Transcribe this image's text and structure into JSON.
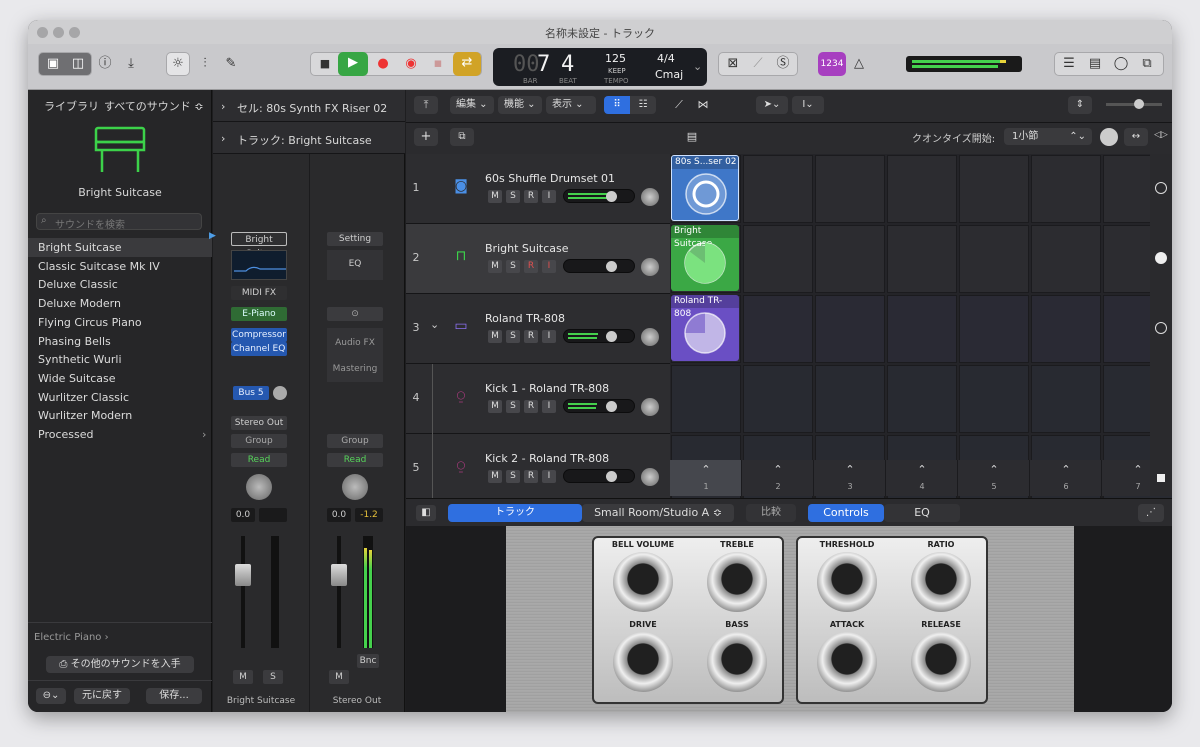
{
  "window": {
    "title": "名称未設定 - トラック"
  },
  "lcd": {
    "bar": "7",
    "beat": "4",
    "bar_label": "BAR",
    "beat_label": "BEAT",
    "tempo": "125",
    "keep": "KEEP",
    "tempo_label": "TEMPO",
    "signature": "4/4",
    "key": "Cmaj",
    "count_in": "1234"
  },
  "library": {
    "header_left": "ライブラリ",
    "header_right": "すべてのサウンド ≎",
    "patch_name": "Bright Suitcase",
    "search_placeholder": "サウンドを検索",
    "items": [
      "Bright Suitcase",
      "Classic Suitcase Mk IV",
      "Deluxe Classic",
      "Deluxe Modern",
      "Flying Circus Piano",
      "Phasing Bells",
      "Synthetic Wurli",
      "Wide Suitcase",
      "Wurlitzer Classic",
      "Wurlitzer Modern",
      "Processed"
    ],
    "footer_category": "Electric Piano",
    "get_more": "その他のサウンドを入手",
    "revert": "元に戻す",
    "save": "保存..."
  },
  "inspector": {
    "cell_label": "セル: 80s Synth FX Riser 02",
    "track_label": "トラック: Bright Suitcase",
    "strip1": {
      "setting": "Bright Suit...",
      "midi_fx": "MIDI FX",
      "instrument": "E-Piano",
      "fx1": "Compressor",
      "fx2": "Channel EQ",
      "send": "Bus 5",
      "output": "Stereo Out",
      "group": "Group",
      "automation": "Read",
      "pan_value": "0.0",
      "m": "M",
      "s": "S",
      "name": "Bright Suitcase"
    },
    "strip2": {
      "setting": "Setting",
      "eq": "EQ",
      "audio_fx": "Audio FX",
      "mastering": "Mastering",
      "group": "Group",
      "automation": "Read",
      "pan_value": "0.0",
      "peak_value": "-1.2",
      "bnc": "Bnc",
      "m": "M",
      "name": "Stereo Out"
    }
  },
  "toolbar": {
    "edit": "編集",
    "functions": "機能",
    "view": "表示",
    "quantize_label": "クオンタイズ開始:",
    "quantize_value": "1小節"
  },
  "tracks": [
    {
      "num": "1",
      "name": "60s Shuffle Drumset 01",
      "m": "M",
      "s": "S",
      "r": "R",
      "i": "I"
    },
    {
      "num": "2",
      "name": "Bright Suitcase",
      "m": "M",
      "s": "S",
      "r": "R",
      "i": "I"
    },
    {
      "num": "3",
      "name": "Roland TR-808",
      "m": "M",
      "s": "S",
      "r": "R",
      "i": "I"
    },
    {
      "num": "4",
      "name": "Kick 1 - Roland TR-808",
      "m": "M",
      "s": "S",
      "r": "R",
      "i": "I"
    },
    {
      "num": "5",
      "name": "Kick 2 - Roland TR-808",
      "m": "M",
      "s": "S",
      "r": "R",
      "i": "I"
    }
  ],
  "clips": [
    {
      "label": "80s S...ser 02",
      "color": "#3f77c8"
    },
    {
      "label": "Bright Suitcase",
      "color": "#3ba845"
    },
    {
      "label": "Roland TR-808",
      "color": "#6a4fc4"
    }
  ],
  "scenes": [
    "1",
    "2",
    "3",
    "4",
    "5",
    "6",
    "7"
  ],
  "smart_controls": {
    "track_tab": "トラック",
    "preset": "Small Room/Studio A",
    "compare": "比較",
    "controls_tab": "Controls",
    "eq_tab": "EQ",
    "knobs_left": [
      "BELL VOLUME",
      "TREBLE",
      "DRIVE",
      "BASS"
    ],
    "knobs_right": [
      "THRESHOLD",
      "RATIO",
      "ATTACK",
      "RELEASE"
    ]
  },
  "icons": [
    "library-icon",
    "inspector-icon",
    "help-icon",
    "download-icon",
    "smart-controls-icon",
    "mixer-icon",
    "editor-icon",
    "stop-icon",
    "play-icon",
    "record-icon",
    "capture-icon",
    "cycle-icon",
    "tuner-icon",
    "metronome-icon",
    "list-icon",
    "notepad-icon",
    "loop-browser-icon",
    "browser-icon"
  ]
}
